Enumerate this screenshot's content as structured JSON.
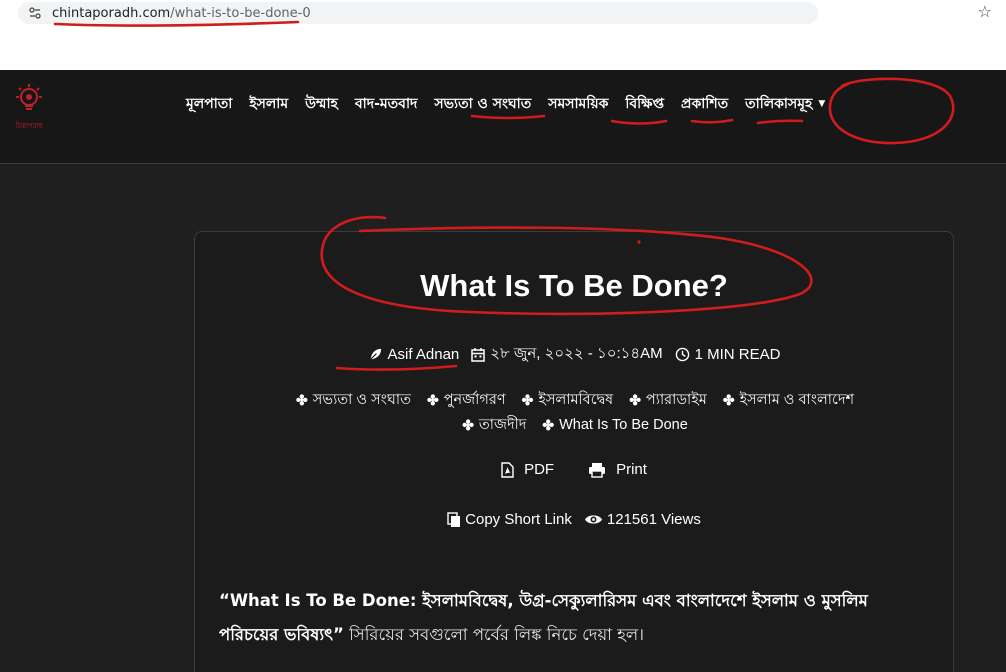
{
  "browser": {
    "url_domain": "chintaporadh.com",
    "url_path": "/what-is-to-be-done-0"
  },
  "site": {
    "logo_text": "চিন্তাপরাধ",
    "nav": [
      {
        "label": "মূলপাতা"
      },
      {
        "label": "ইসলাম"
      },
      {
        "label": "উম্মাহ"
      },
      {
        "label": "বাদ-মতবাদ"
      },
      {
        "label": "সভ্যতা ও সংঘাত"
      },
      {
        "label": "সমসাময়িক"
      },
      {
        "label": "বিক্ষিপ্ত"
      },
      {
        "label": "প্রকাশিত"
      },
      {
        "label": "তালিকাসমূহ"
      }
    ]
  },
  "article": {
    "title": "What Is To Be Done?",
    "author": "Asif Adnan",
    "date": "২৮ জুন, ২০২২ - ১০:১৪AM",
    "read_time": "1 MIN READ",
    "tags": [
      "সভ্যতা ও সংঘাত",
      "পুনর্জাগরণ",
      "ইসলামবিদ্বেষ",
      "প্যারাডাইম",
      "ইসলাম ও বাংলাদেশ",
      "তাজদীদ",
      "What Is To Be Done"
    ],
    "pdf_label": "PDF",
    "print_label": "Print",
    "copy_link_label": "Copy Short Link",
    "views": "121561 Views",
    "excerpt_bold": "“What Is To Be Done: ইসলামবিদ্বেষ, উগ্র-সেক্যুলারিসম এবং বাংলাদেশে ইসলাম ও মুসলিম পরিচয়ের ভবিষ্যৎ”",
    "excerpt_rest": " সিরিয়ের সবগুলো পর্বের লিঙ্ক নিচে দেয়া হল।"
  },
  "colors": {
    "page_bg": "#1f1f1f",
    "header_bg": "#171717",
    "annotation": "#d01c1c"
  }
}
